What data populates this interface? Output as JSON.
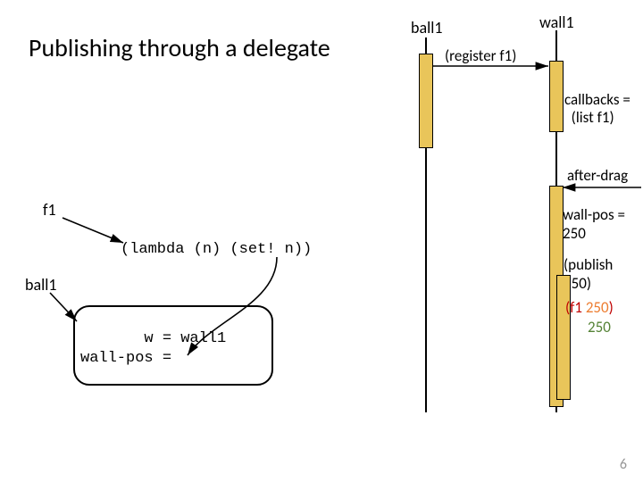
{
  "title": "Publishing through a delegate",
  "lifelines": {
    "ball1": "ball1",
    "wall1": "wall1"
  },
  "messages": {
    "register": "(register f1)",
    "callbacks": "callbacks =\n  (list f1)",
    "after_drag": "after-drag",
    "wall_pos_250": "wall-pos = 250",
    "publish_250": "(publish 250)"
  },
  "closure": {
    "f1_label": "f1",
    "lambda": "(lambda (n) (set!      n))",
    "ball1_label": "ball1",
    "obj_w_line": "       w = wall1",
    "obj_wp_line": "wall-pos ="
  },
  "call_result": {
    "call_open": "(",
    "call_f1": "f1 ",
    "call_arg": "250",
    "call_close": ")",
    "result": "250"
  },
  "pagenum": "6"
}
